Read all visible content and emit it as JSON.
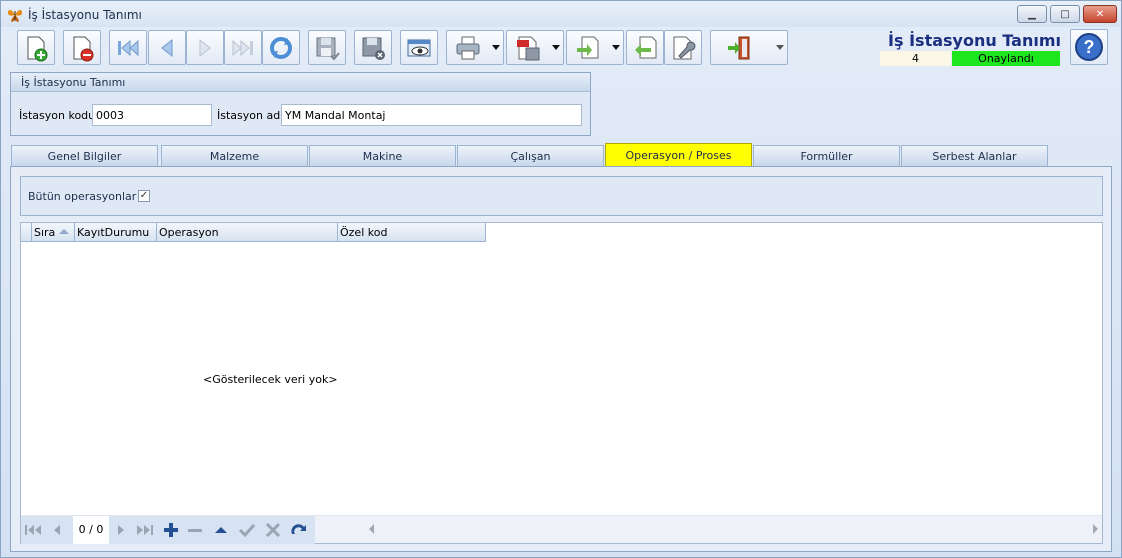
{
  "window": {
    "title": "İş İstasyonu Tanımı",
    "minimize": "▁",
    "maximize": "□",
    "close": "✕"
  },
  "header": {
    "title": "İş İstasyonu Tanımı",
    "record_count": "4",
    "status": "Onaylandı",
    "status_color": "#1ee61e"
  },
  "toolbar": {
    "icons": [
      "new-document-icon",
      "delete-document-icon",
      "first-record-icon",
      "previous-record-icon",
      "next-record-icon",
      "last-record-icon",
      "refresh-icon",
      "save-icon",
      "save-close-icon",
      "preview-icon",
      "print-icon",
      "pdf-export-icon",
      "export-icon",
      "import-icon",
      "settings-icon",
      "exit-icon",
      "help-icon"
    ]
  },
  "group": {
    "title": "İş İstasyonu Tanımı",
    "code_label": "İstasyon kodu",
    "code_value": "0003",
    "name_label": "İstasyon adı",
    "name_value": "YM Mandal Montaj"
  },
  "tabs": [
    {
      "label": "Genel Bilgiler"
    },
    {
      "label": "Malzeme"
    },
    {
      "label": "Makine"
    },
    {
      "label": "Çalışan"
    },
    {
      "label": "Operasyon / Proses"
    },
    {
      "label": "Formüller"
    },
    {
      "label": "Serbest Alanlar"
    }
  ],
  "active_tab_color": "#ffff00",
  "panel": {
    "filter_label": "Bütün operasyonlar",
    "checkbox_mark": "✓",
    "columns": [
      "Sıra",
      "KayıtDurumu",
      "Operasyon",
      "Özel kod"
    ],
    "empty_message": "<Gösterilecek veri yok>",
    "nav_count": "0 / 0"
  }
}
